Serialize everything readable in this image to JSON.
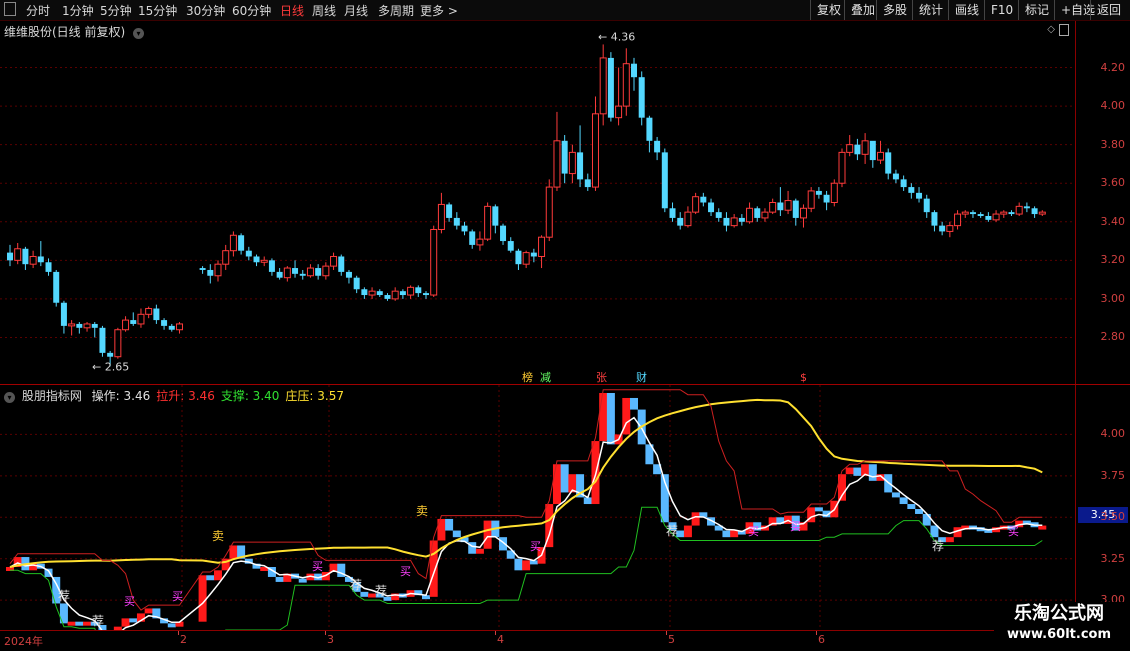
{
  "toolbar": {
    "left_items": [
      "分时",
      "1分钟",
      "5分钟",
      "15分钟",
      "30分钟",
      "60分钟",
      "日线",
      "周线",
      "月线",
      "多周期",
      "更多 >"
    ],
    "active": "日线",
    "right_items": [
      "复权",
      "叠加",
      "多股",
      "统计",
      "画线",
      "F10",
      "标记",
      "+自选",
      "返回"
    ]
  },
  "main_panel": {
    "title": "维维股份(日线 前复权)",
    "high_label": "4.36",
    "low_label": "2.65",
    "y_ticks": [
      "4.20",
      "4.00",
      "3.80",
      "3.60",
      "3.40",
      "3.20",
      "3.00",
      "2.80"
    ],
    "markers": [
      "榜",
      "减",
      "张",
      "财",
      "$"
    ]
  },
  "indicator_panel": {
    "name": "股朋指标网",
    "values": [
      {
        "label": "操作:",
        "value": "3.46",
        "color": "#e0e0e0"
      },
      {
        "label": "拉升:",
        "value": "3.46",
        "color": "#ff3030"
      },
      {
        "label": "支撑:",
        "value": "3.40",
        "color": "#30e030"
      },
      {
        "label": "庄压:",
        "value": "3.57",
        "color": "#ffe030"
      }
    ],
    "y_ticks": [
      "4.00",
      "3.75",
      "3.50",
      "3.25",
      "3.00"
    ],
    "current_price": "3.45",
    "signal_labels": [
      "荐",
      "荐",
      "卖",
      "荐",
      "荐",
      "卖",
      "荐",
      "荐"
    ],
    "buy_label": "买"
  },
  "time_axis": {
    "labels": [
      "2024年",
      "2",
      "3",
      "4",
      "5",
      "6"
    ]
  },
  "watermark": {
    "line1": "乐淘公式网",
    "line2": "www.60lt.com"
  },
  "chart_data": {
    "type": "candlestick",
    "price_range": [
      2.6,
      4.4
    ],
    "candles": [
      [
        3.24,
        3.2,
        3.28,
        3.17
      ],
      [
        3.2,
        3.26,
        3.29,
        3.18
      ],
      [
        3.26,
        3.18,
        3.27,
        3.15
      ],
      [
        3.18,
        3.22,
        3.25,
        3.16
      ],
      [
        3.22,
        3.19,
        3.3,
        3.17
      ],
      [
        3.19,
        3.14,
        3.21,
        3.12
      ],
      [
        3.14,
        2.98,
        3.15,
        2.96
      ],
      [
        2.98,
        2.86,
        2.99,
        2.82
      ],
      [
        2.86,
        2.87,
        2.89,
        2.81
      ],
      [
        2.87,
        2.85,
        2.88,
        2.82
      ],
      [
        2.85,
        2.87,
        2.88,
        2.83
      ],
      [
        2.87,
        2.85,
        2.88,
        2.8
      ],
      [
        2.85,
        2.72,
        2.86,
        2.7
      ],
      [
        2.72,
        2.7,
        2.73,
        2.65
      ],
      [
        2.7,
        2.84,
        2.85,
        2.69
      ],
      [
        2.84,
        2.89,
        2.91,
        2.83
      ],
      [
        2.89,
        2.87,
        2.93,
        2.86
      ],
      [
        2.87,
        2.92,
        2.95,
        2.85
      ],
      [
        2.92,
        2.95,
        2.96,
        2.9
      ],
      [
        2.95,
        2.89,
        2.97,
        2.87
      ],
      [
        2.89,
        2.86,
        2.9,
        2.84
      ],
      [
        2.86,
        2.84,
        2.87,
        2.83
      ],
      [
        2.84,
        2.87,
        2.88,
        2.82
      ],
      [
        3.16,
        3.15,
        3.17,
        3.13
      ],
      [
        3.15,
        3.12,
        3.18,
        3.08
      ],
      [
        3.12,
        3.18,
        3.2,
        3.09
      ],
      [
        3.18,
        3.25,
        3.28,
        3.15
      ],
      [
        3.25,
        3.33,
        3.35,
        3.22
      ],
      [
        3.33,
        3.25,
        3.34,
        3.23
      ],
      [
        3.25,
        3.22,
        3.27,
        3.2
      ],
      [
        3.22,
        3.19,
        3.23,
        3.17
      ],
      [
        3.19,
        3.2,
        3.22,
        3.17
      ],
      [
        3.2,
        3.14,
        3.21,
        3.12
      ],
      [
        3.14,
        3.11,
        3.16,
        3.1
      ],
      [
        3.11,
        3.16,
        3.17,
        3.09
      ],
      [
        3.16,
        3.13,
        3.2,
        3.11
      ],
      [
        3.13,
        3.12,
        3.15,
        3.1
      ],
      [
        3.12,
        3.16,
        3.18,
        3.11
      ],
      [
        3.16,
        3.12,
        3.18,
        3.1
      ],
      [
        3.12,
        3.17,
        3.19,
        3.1
      ],
      [
        3.17,
        3.22,
        3.24,
        3.15
      ],
      [
        3.22,
        3.14,
        3.23,
        3.12
      ],
      [
        3.14,
        3.11,
        3.15,
        3.08
      ],
      [
        3.11,
        3.05,
        3.12,
        3.03
      ],
      [
        3.05,
        3.02,
        3.06,
        3.0
      ],
      [
        3.02,
        3.04,
        3.06,
        3.0
      ],
      [
        3.04,
        3.02,
        3.05,
        3.01
      ],
      [
        3.02,
        3.0,
        3.03,
        2.99
      ],
      [
        3.0,
        3.04,
        3.06,
        2.99
      ],
      [
        3.04,
        3.02,
        3.05,
        3.0
      ],
      [
        3.02,
        3.06,
        3.07,
        3.0
      ],
      [
        3.06,
        3.03,
        3.07,
        3.01
      ],
      [
        3.03,
        3.02,
        3.04,
        3.0
      ],
      [
        3.02,
        3.36,
        3.38,
        3.01
      ],
      [
        3.36,
        3.49,
        3.55,
        3.34
      ],
      [
        3.49,
        3.42,
        3.5,
        3.4
      ],
      [
        3.42,
        3.38,
        3.45,
        3.36
      ],
      [
        3.38,
        3.35,
        3.4,
        3.33
      ],
      [
        3.35,
        3.28,
        3.36,
        3.26
      ],
      [
        3.28,
        3.31,
        3.35,
        3.25
      ],
      [
        3.31,
        3.48,
        3.5,
        3.3
      ],
      [
        3.48,
        3.38,
        3.49,
        3.34
      ],
      [
        3.38,
        3.3,
        3.39,
        3.28
      ],
      [
        3.3,
        3.25,
        3.32,
        3.24
      ],
      [
        3.25,
        3.18,
        3.26,
        3.15
      ],
      [
        3.18,
        3.24,
        3.25,
        3.16
      ],
      [
        3.24,
        3.22,
        3.26,
        3.19
      ],
      [
        3.22,
        3.32,
        3.33,
        3.16
      ],
      [
        3.32,
        3.58,
        3.62,
        3.3
      ],
      [
        3.58,
        3.82,
        3.97,
        3.56
      ],
      [
        3.82,
        3.65,
        3.85,
        3.6
      ],
      [
        3.65,
        3.76,
        3.8,
        3.6
      ],
      [
        3.76,
        3.62,
        3.9,
        3.58
      ],
      [
        3.62,
        3.58,
        3.65,
        3.56
      ],
      [
        3.58,
        3.96,
        4.05,
        3.56
      ],
      [
        3.96,
        4.25,
        4.32,
        3.9
      ],
      [
        4.25,
        3.94,
        4.28,
        3.92
      ],
      [
        3.94,
        4.0,
        4.2,
        3.9
      ],
      [
        4.0,
        4.22,
        4.3,
        3.95
      ],
      [
        4.22,
        4.15,
        4.25,
        4.08
      ],
      [
        4.15,
        3.94,
        4.18,
        3.9
      ],
      [
        3.94,
        3.82,
        3.95,
        3.76
      ],
      [
        3.82,
        3.76,
        3.84,
        3.72
      ],
      [
        3.76,
        3.47,
        3.78,
        3.45
      ],
      [
        3.47,
        3.42,
        3.5,
        3.4
      ],
      [
        3.42,
        3.38,
        3.45,
        3.36
      ],
      [
        3.38,
        3.45,
        3.48,
        3.37
      ],
      [
        3.45,
        3.53,
        3.55,
        3.44
      ],
      [
        3.53,
        3.5,
        3.55,
        3.48
      ],
      [
        3.5,
        3.45,
        3.52,
        3.43
      ],
      [
        3.45,
        3.42,
        3.47,
        3.4
      ],
      [
        3.42,
        3.38,
        3.45,
        3.35
      ],
      [
        3.38,
        3.42,
        3.44,
        3.37
      ],
      [
        3.42,
        3.4,
        3.44,
        3.38
      ],
      [
        3.4,
        3.47,
        3.5,
        3.39
      ],
      [
        3.47,
        3.42,
        3.48,
        3.4
      ],
      [
        3.42,
        3.45,
        3.47,
        3.4
      ],
      [
        3.45,
        3.5,
        3.52,
        3.44
      ],
      [
        3.5,
        3.46,
        3.58,
        3.43
      ],
      [
        3.46,
        3.51,
        3.56,
        3.44
      ],
      [
        3.51,
        3.42,
        3.52,
        3.38
      ],
      [
        3.42,
        3.47,
        3.49,
        3.37
      ],
      [
        3.47,
        3.56,
        3.58,
        3.45
      ],
      [
        3.56,
        3.54,
        3.58,
        3.52
      ],
      [
        3.54,
        3.5,
        3.56,
        3.46
      ],
      [
        3.5,
        3.6,
        3.62,
        3.48
      ],
      [
        3.6,
        3.76,
        3.78,
        3.58
      ],
      [
        3.76,
        3.8,
        3.85,
        3.74
      ],
      [
        3.8,
        3.75,
        3.83,
        3.72
      ],
      [
        3.75,
        3.82,
        3.86,
        3.7
      ],
      [
        3.82,
        3.72,
        3.8,
        3.68
      ],
      [
        3.72,
        3.76,
        3.82,
        3.7
      ],
      [
        3.76,
        3.65,
        3.78,
        3.62
      ],
      [
        3.65,
        3.62,
        3.67,
        3.6
      ],
      [
        3.62,
        3.58,
        3.64,
        3.56
      ],
      [
        3.58,
        3.55,
        3.6,
        3.52
      ],
      [
        3.55,
        3.52,
        3.58,
        3.5
      ],
      [
        3.52,
        3.45,
        3.54,
        3.42
      ],
      [
        3.45,
        3.38,
        3.46,
        3.35
      ],
      [
        3.38,
        3.35,
        3.4,
        3.33
      ],
      [
        3.35,
        3.38,
        3.4,
        3.32
      ],
      [
        3.38,
        3.44,
        3.46,
        3.36
      ],
      [
        3.44,
        3.45,
        3.46,
        3.42
      ],
      [
        3.45,
        3.44,
        3.46,
        3.42
      ],
      [
        3.44,
        3.43,
        3.45,
        3.42
      ],
      [
        3.43,
        3.41,
        3.45,
        3.4
      ],
      [
        3.41,
        3.44,
        3.46,
        3.4
      ],
      [
        3.44,
        3.45,
        3.46,
        3.42
      ],
      [
        3.45,
        3.44,
        3.46,
        3.43
      ],
      [
        3.44,
        3.48,
        3.5,
        3.43
      ],
      [
        3.48,
        3.47,
        3.5,
        3.45
      ],
      [
        3.47,
        3.44,
        3.48,
        3.42
      ],
      [
        3.44,
        3.45,
        3.46,
        3.43
      ]
    ]
  }
}
